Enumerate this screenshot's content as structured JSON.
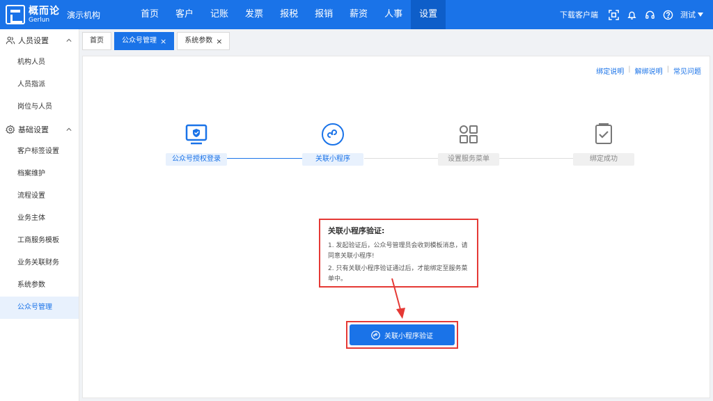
{
  "header": {
    "logo_cn": "概而论",
    "logo_en": "Gerlun",
    "org_name": "演示机构",
    "nav": [
      "首页",
      "客户",
      "记账",
      "发票",
      "报税",
      "报销",
      "薪资",
      "人事",
      "设置"
    ],
    "active_nav": "设置",
    "download_label": "下载客户端",
    "user_name": "测试"
  },
  "sidebar": {
    "groups": [
      {
        "label": "人员设置",
        "items": [
          "机构人员",
          "人员指派",
          "岗位与人员"
        ]
      },
      {
        "label": "基础设置",
        "items": [
          "客户标签设置",
          "档案维护",
          "流程设置",
          "业务主体",
          "工商服务模板",
          "业务关联财务",
          "系统参数",
          "公众号管理"
        ]
      }
    ],
    "active_item": "公众号管理"
  },
  "tabs": [
    {
      "label": "首页",
      "closable": false
    },
    {
      "label": "公众号管理",
      "closable": true
    },
    {
      "label": "系统参数",
      "closable": true
    }
  ],
  "tab_close_symbol": "×",
  "help_links": [
    "绑定说明",
    "解绑说明",
    "常见问题"
  ],
  "help_sep": "|",
  "steps": [
    {
      "label": "公众号授权登录",
      "icon": "monitor-shield-icon",
      "status": "done"
    },
    {
      "label": "关联小程序",
      "icon": "miniprogram-icon",
      "status": "current"
    },
    {
      "label": "设置服务菜单",
      "icon": "grid-menu-icon",
      "status": "todo"
    },
    {
      "label": "绑定成功",
      "icon": "check-document-icon",
      "status": "todo"
    }
  ],
  "note": {
    "title": "关联小程序验证:",
    "lines": [
      "1. 发起验证后，公众号管理员会收到模板消息，请同意关联小程序!",
      "2. 只有关联小程序验证通过后，才能绑定至服务菜单中。"
    ]
  },
  "verify_button": {
    "label": "关联小程序验证",
    "icon": "miniprogram-icon"
  },
  "colors": {
    "primary": "#1a73e8",
    "highlight": "#e53935"
  }
}
